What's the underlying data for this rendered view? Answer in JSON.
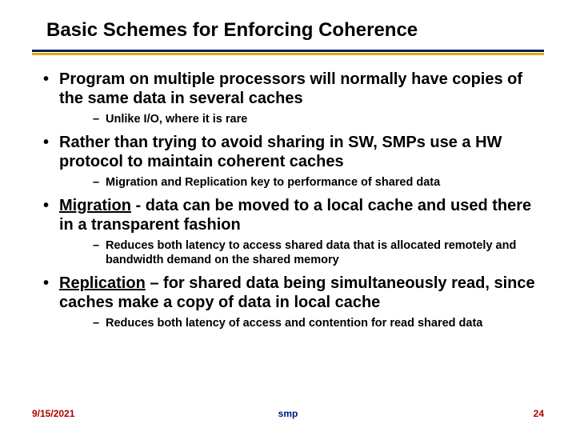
{
  "title": "Basic Schemes for Enforcing Coherence",
  "bullets": [
    {
      "text": "Program on multiple processors will normally have copies of the same data in several caches",
      "sub": [
        "Unlike I/O, where it is rare"
      ]
    },
    {
      "text": "Rather than trying to avoid sharing in SW, SMPs use a HW protocol to maintain coherent caches",
      "sub": [
        "Migration and Replication key to performance of shared data"
      ]
    },
    {
      "keyword": "Migration",
      "rest": " - data can be moved to a local cache and used there in a transparent fashion",
      "sub": [
        "Reduces both latency to access shared data that is allocated remotely and bandwidth demand on the shared memory"
      ]
    },
    {
      "keyword": "Replication",
      "rest": " – for shared data being simultaneously read, since caches make a copy of data in local cache",
      "sub": [
        "Reduces both latency of access and contention for read shared data"
      ]
    }
  ],
  "footer": {
    "date": "9/15/2021",
    "center": "smp",
    "page": "24"
  }
}
